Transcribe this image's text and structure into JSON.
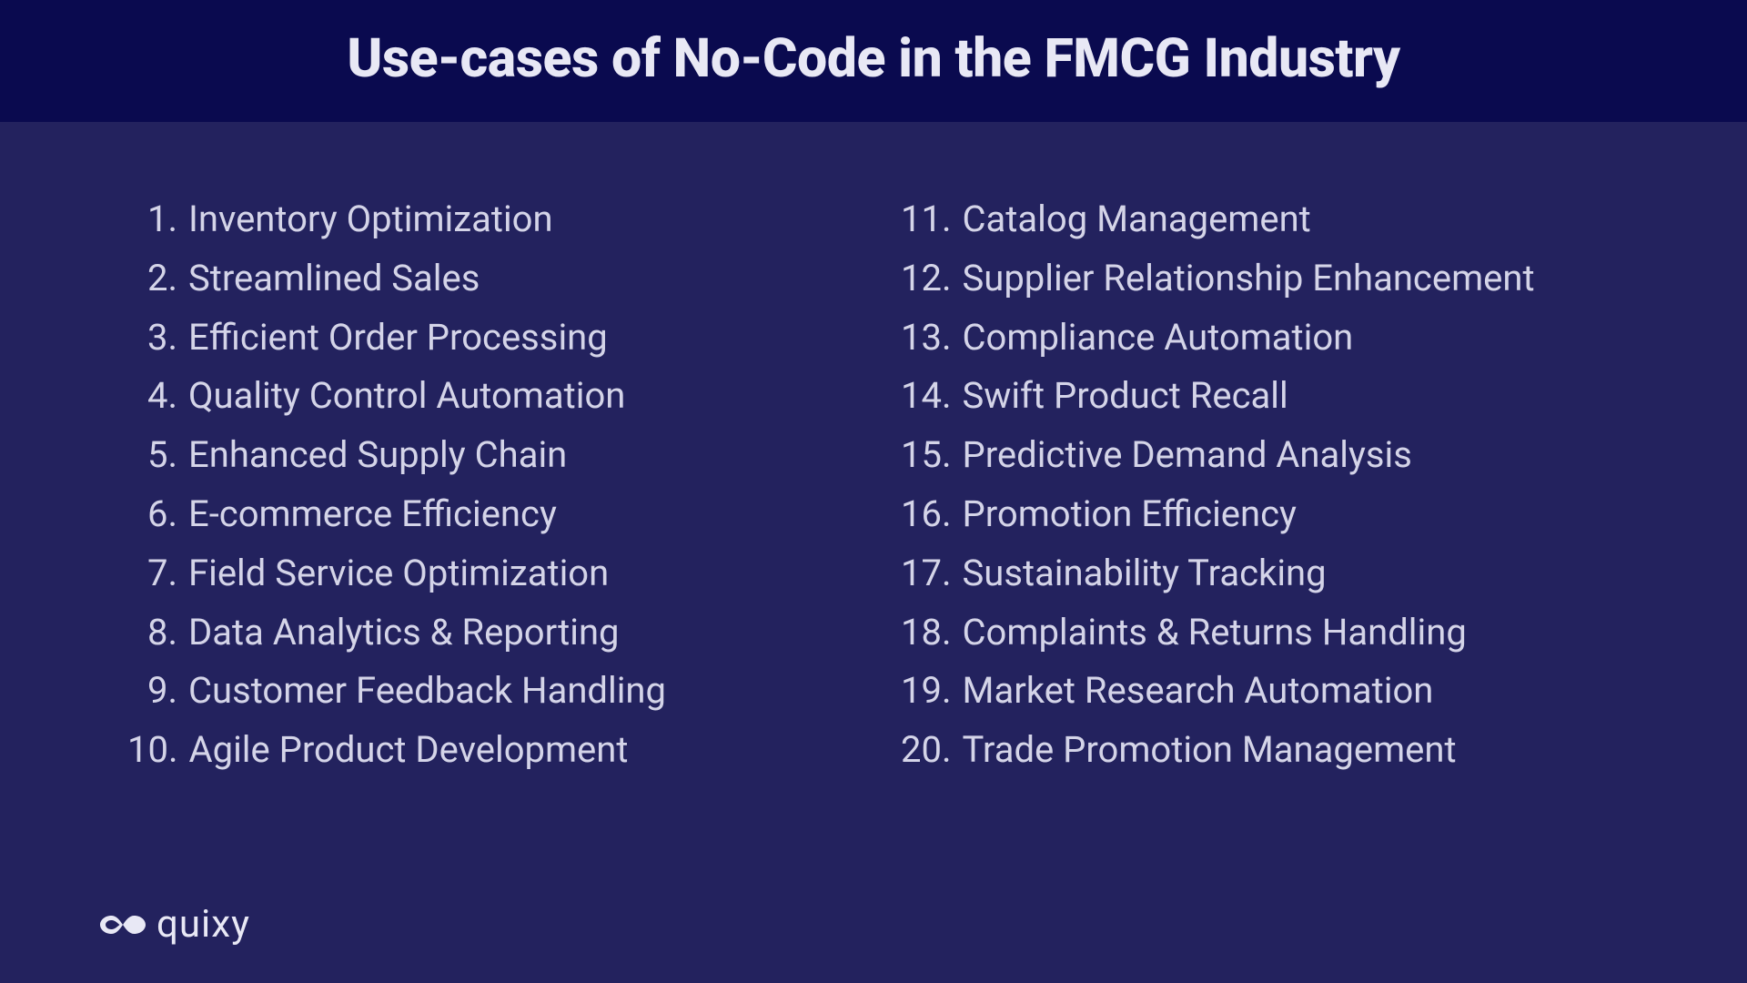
{
  "header": {
    "title": "Use-cases of No-Code in the FMCG Industry"
  },
  "items_left": [
    {
      "num": "1.",
      "text": "Inventory Optimization"
    },
    {
      "num": "2.",
      "text": "Streamlined Sales"
    },
    {
      "num": "3.",
      "text": "Efficient Order Processing"
    },
    {
      "num": "4.",
      "text": "Quality Control Automation"
    },
    {
      "num": "5.",
      "text": "Enhanced Supply Chain"
    },
    {
      "num": "6.",
      "text": "E-commerce Efficiency"
    },
    {
      "num": "7.",
      "text": "Field Service Optimization"
    },
    {
      "num": "8.",
      "text": "Data Analytics & Reporting"
    },
    {
      "num": "9.",
      "text": "Customer Feedback Handling"
    },
    {
      "num": "10.",
      "text": "Agile Product Development"
    }
  ],
  "items_right": [
    {
      "num": "11.",
      "text": "Catalog Management"
    },
    {
      "num": "12.",
      "text": "Supplier Relationship Enhancement"
    },
    {
      "num": "13.",
      "text": "Compliance Automation"
    },
    {
      "num": "14.",
      "text": "Swift Product Recall"
    },
    {
      "num": "15.",
      "text": "Predictive Demand Analysis"
    },
    {
      "num": "16.",
      "text": "Promotion Efficiency"
    },
    {
      "num": "17.",
      "text": "Sustainability Tracking"
    },
    {
      "num": "18.",
      "text": "Complaints & Returns Handling"
    },
    {
      "num": "19.",
      "text": "Market Research Automation"
    },
    {
      "num": "20.",
      "text": "Trade Promotion Management"
    }
  ],
  "brand": {
    "name": "quixy"
  }
}
